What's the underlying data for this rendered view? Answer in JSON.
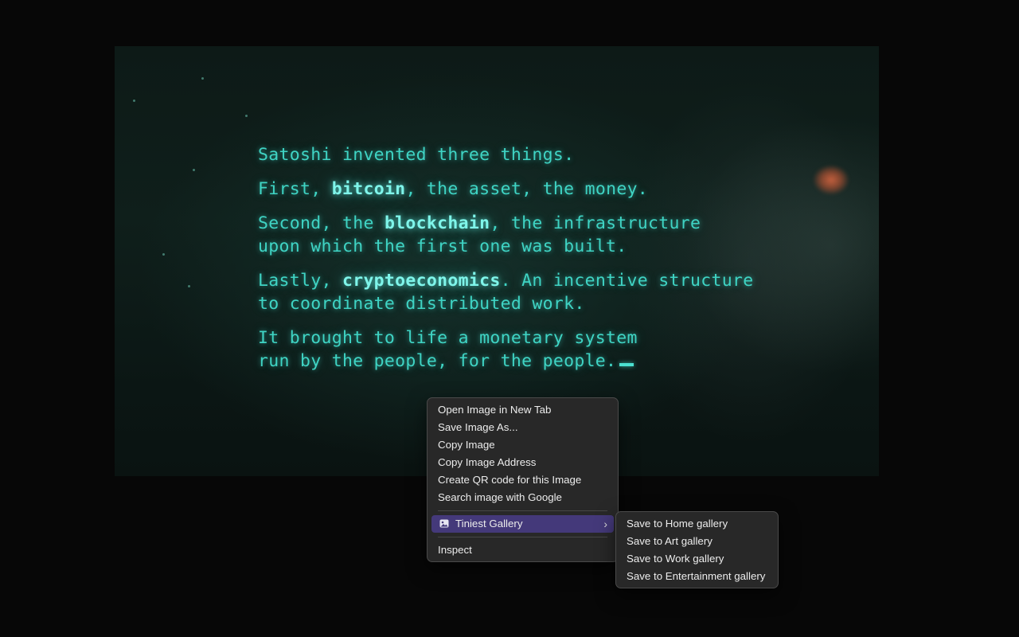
{
  "media": {
    "paragraphs": [
      {
        "lines": [
          [
            {
              "t": "Satoshi invented three things."
            }
          ]
        ]
      },
      {
        "lines": [
          [
            {
              "t": "First, "
            },
            {
              "t": "bitcoin",
              "hl": true
            },
            {
              "t": ", the asset, the money."
            }
          ]
        ]
      },
      {
        "lines": [
          [
            {
              "t": "Second, the "
            },
            {
              "t": "blockchain",
              "hl": true
            },
            {
              "t": ", the infrastructure"
            }
          ],
          [
            {
              "t": "upon which the first one was built."
            }
          ]
        ]
      },
      {
        "lines": [
          [
            {
              "t": "Lastly, "
            },
            {
              "t": "cryptoeconomics",
              "hl": true
            },
            {
              "t": ". An incentive structure"
            }
          ],
          [
            {
              "t": "to coordinate distributed work."
            }
          ]
        ]
      },
      {
        "lines": [
          [
            {
              "t": "It brought to life a monetary system"
            }
          ],
          [
            {
              "t": "run by the people, for the people."
            }
          ]
        ],
        "cursor": true
      }
    ],
    "text_color": "#3fd4c4"
  },
  "context_menu": {
    "items": [
      {
        "label": "Open Image in New Tab"
      },
      {
        "label": "Save Image As..."
      },
      {
        "label": "Copy Image"
      },
      {
        "label": "Copy Image Address"
      },
      {
        "label": "Create QR code for this Image"
      },
      {
        "label": "Search image with Google"
      }
    ],
    "extension_item": {
      "label": "Tiniest Gallery",
      "icon": "image-icon",
      "submenu_indicator": "›"
    },
    "inspect_label": "Inspect",
    "highlight_color": "#44397a"
  },
  "submenu": {
    "items": [
      {
        "label": "Save to Home gallery"
      },
      {
        "label": "Save to Art gallery"
      },
      {
        "label": "Save to Work gallery"
      },
      {
        "label": "Save to Entertainment gallery"
      }
    ]
  }
}
